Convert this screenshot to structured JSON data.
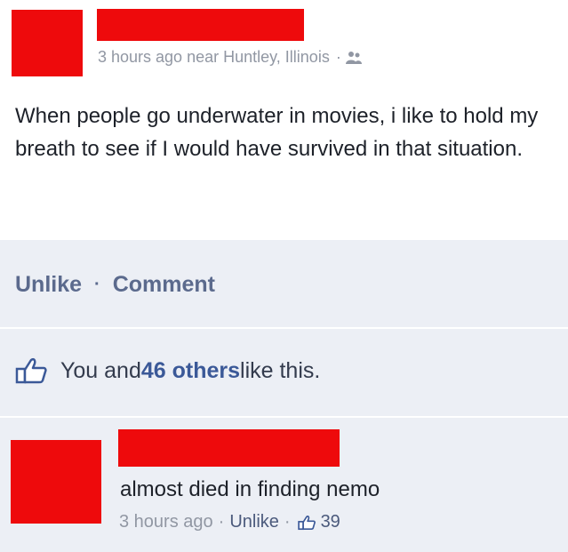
{
  "post": {
    "timestamp": "3 hours ago near Huntley, Illinois",
    "meta_dot": "·",
    "audience_icon": "friends-icon",
    "text": "When people go underwater in movies, i like to hold my breath to see if I would have survived in that situation."
  },
  "actions": {
    "unlike": "Unlike",
    "separator": "·",
    "comment": "Comment"
  },
  "likes": {
    "icon": "thumbs-up-icon",
    "prefix": "You and ",
    "count_link": "46 others",
    "suffix": " like this."
  },
  "comment": {
    "text": "almost died in finding nemo",
    "timestamp": "3 hours ago",
    "dot": "·",
    "unlike": "Unlike",
    "like_icon": "thumbs-up-icon",
    "like_count": "39"
  },
  "colors": {
    "redaction": "#ee0a0c",
    "link": "#3b5998",
    "meta": "#9197a3",
    "action_area": "#eceff5"
  }
}
